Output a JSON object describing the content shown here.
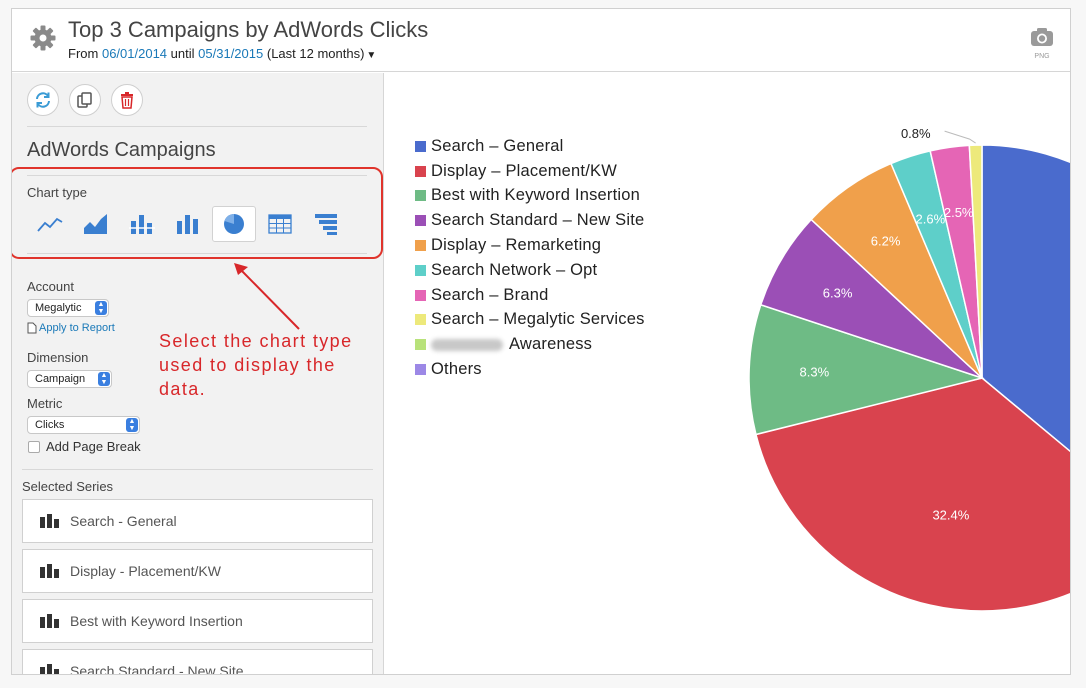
{
  "header": {
    "title": "Top 3 Campaigns by AdWords Clicks",
    "from_label": "From",
    "start_date": "06/01/2014",
    "until_label": "until",
    "end_date": "05/31/2015",
    "range_note": "(Last 12 months)",
    "camera_caption": "PNG",
    "icons": {
      "settings": "gear-icon",
      "export": "camera-icon"
    }
  },
  "panel": {
    "action_icons": [
      "refresh-icon",
      "duplicate-icon",
      "trash-icon"
    ],
    "section_title": "AdWords Campaigns",
    "chart_type_label": "Chart type",
    "chart_types": [
      "line",
      "area",
      "stacked-bar",
      "bar",
      "pie",
      "table",
      "funnel"
    ],
    "selected_chart_type": "pie",
    "account_label": "Account",
    "account_value": "Megalytic",
    "apply_link": "Apply to Report",
    "dimension_label": "Dimension",
    "dimension_value": "Campaign",
    "metric_label": "Metric",
    "metric_value": "Clicks",
    "page_break_label": "Add Page Break",
    "page_break_checked": false,
    "selected_series_label": "Selected Series",
    "series": [
      "Search - General",
      "Display - Placement/KW",
      "Best with Keyword Insertion",
      "Search Standard - New Site"
    ]
  },
  "annotation": {
    "text": "Select the chart type used to display the data.",
    "color": "#d8272a"
  },
  "chart_data": {
    "type": "pie",
    "legend_placement": "left",
    "legend": [
      "Search – General",
      "Display – Placement/KW",
      "Best with Keyword Insertion",
      "Search Standard – New Site",
      "Display – Remarketing",
      "Search Network – Opt",
      "Search – Brand",
      "Search – Megalytic Services",
      "Awareness",
      "Others"
    ],
    "values": [
      33.3,
      32.4,
      8.3,
      6.3,
      6.2,
      2.6,
      2.5,
      0.8,
      0.0,
      0.0
    ],
    "labels": [
      "",
      "32.4%",
      "8.3%",
      "6.3%",
      "6.2%",
      "2.6%",
      "2.5%",
      "0.8%",
      "",
      ""
    ],
    "colors": [
      "#4a6bcd",
      "#d9434e",
      "#6ebb85",
      "#9b4fb6",
      "#f0a04b",
      "#5ecfc9",
      "#e565b5",
      "#ede97b",
      "#b8e27a",
      "#9c88e6"
    ]
  }
}
